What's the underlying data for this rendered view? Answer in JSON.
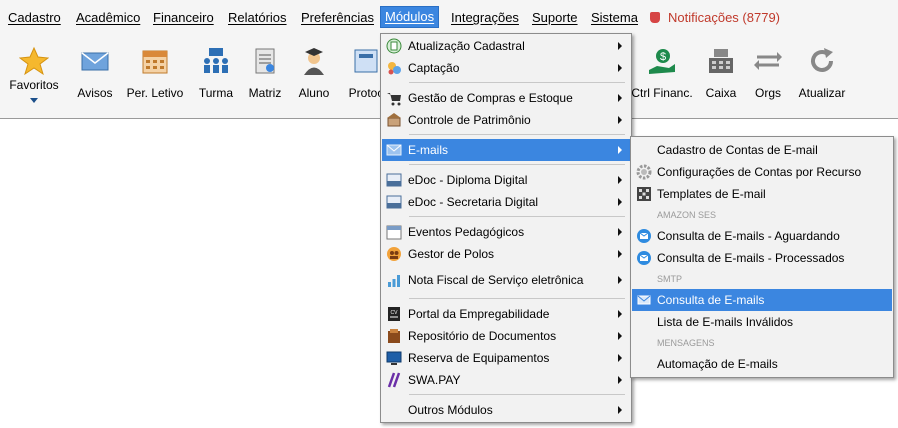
{
  "menubar": {
    "items": [
      "Cadastro",
      "Acadêmico",
      "Financeiro",
      "Relatórios",
      "Preferências",
      "Módulos",
      "Integrações",
      "Suporte",
      "Sistema"
    ],
    "notifications": "Notificações (8779)"
  },
  "toolbar": {
    "favoritos": "Favoritos",
    "avisos": "Avisos",
    "periodo": "Per. Letivo",
    "turma": "Turma",
    "matriz": "Matriz",
    "aluno": "Aluno",
    "protocolo": "Protoc",
    "ctrl_financ": "Ctrl Financ.",
    "caixa": "Caixa",
    "orgs": "Orgs",
    "atualizar": "Atualizar"
  },
  "modulos_menu": {
    "items": [
      "Atualização Cadastral",
      "Captação",
      "Gestão de Compras e Estoque",
      "Controle de Patrimônio",
      "E-mails",
      "eDoc - Diploma Digital",
      "eDoc - Secretaria Digital",
      "Eventos Pedagógicos",
      "Gestor de Polos",
      "Nota Fiscal de Serviço eletrônica",
      "Portal da Empregabilidade",
      "Repositório de Documentos",
      "Reserva de Equipamentos",
      "SWA.PAY",
      "Outros Módulos"
    ]
  },
  "emails_menu": {
    "items": [
      "Cadastro de Contas de E-mail",
      "Configurações de Contas por Recurso",
      "Templates de E-mail",
      "Consulta de E-mails - Aguardando",
      "Consulta de E-mails - Processados",
      "Consulta de E-mails",
      "Lista de E-mails Inválidos",
      "Automação de E-mails"
    ],
    "headers": [
      "AMAZON SES",
      "SMTP",
      "MENSAGENS"
    ]
  },
  "colors": {
    "highlight": "#3b86e0",
    "notification": "#c0392b"
  }
}
